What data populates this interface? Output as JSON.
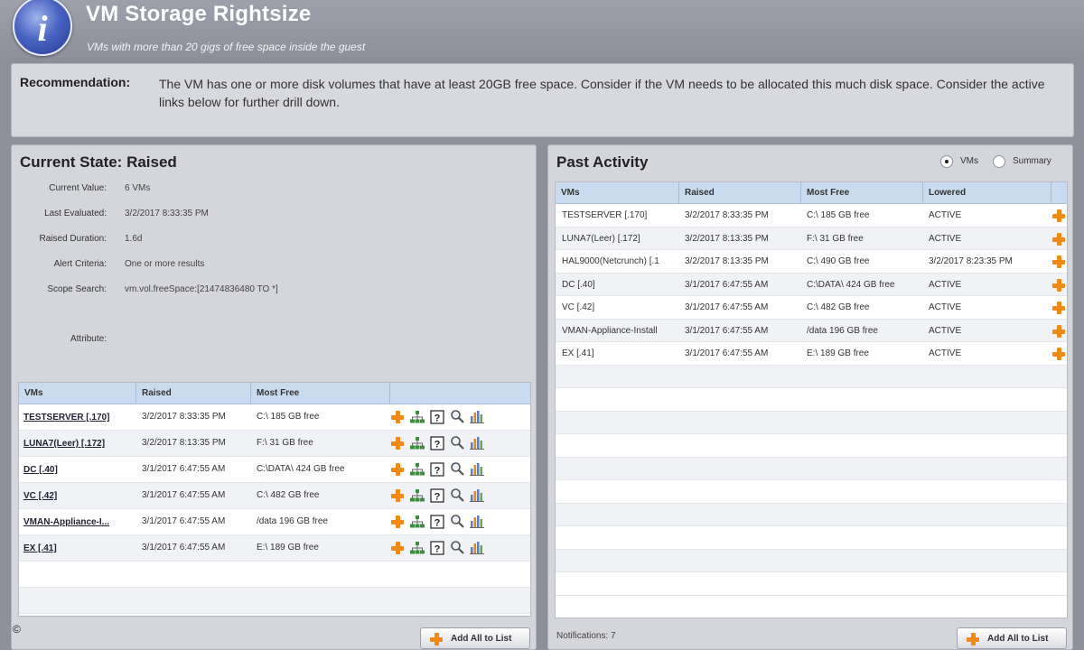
{
  "header": {
    "icon": "info-icon",
    "icon_glyph": "i",
    "title": "VM Storage Rightsize",
    "subtitle": "VMs with more than 20 gigs of free space inside the guest"
  },
  "recommendation": {
    "label": "Recommendation:",
    "text": "The VM has one or more disk volumes that have at least 20GB free space. Consider if the VM needs to be allocated this much disk space. Consider the active links below for further drill down."
  },
  "current_state": {
    "title": "Current State: Raised",
    "details": [
      {
        "label": "Current Value:",
        "value": "6 VMs"
      },
      {
        "label": "Last Evaluated:",
        "value": "3/2/2017 8:33:35 PM"
      },
      {
        "label": "Raised Duration:",
        "value": "1.6d"
      },
      {
        "label": "Alert Criteria:",
        "value": "One or more results"
      },
      {
        "label": "Scope Search:",
        "value": "vm.vol.freeSpace:[21474836480 TO *]"
      },
      {
        "label": "Attribute:",
        "value": ""
      }
    ],
    "columns": [
      "VMs",
      "Raised",
      "Most Free"
    ],
    "rows": [
      {
        "vm": "TESTSERVER [.170]",
        "raised": "3/2/2017 8:33:35 PM",
        "most_free": "C:\\ 185 GB free"
      },
      {
        "vm": "LUNA7(Leer) [.172]",
        "raised": "3/2/2017 8:13:35 PM",
        "most_free": "F:\\ 31 GB free"
      },
      {
        "vm": "DC [.40]",
        "raised": "3/1/2017 6:47:55 AM",
        "most_free": "C:\\DATA\\ 424 GB free"
      },
      {
        "vm": "VC [.42]",
        "raised": "3/1/2017 6:47:55 AM",
        "most_free": "C:\\ 482 GB free"
      },
      {
        "vm": "VMAN-Appliance-I...",
        "raised": "3/1/2017 6:47:55 AM",
        "most_free": "/data 196 GB free"
      },
      {
        "vm": "EX [.41]",
        "raised": "3/1/2017 6:47:55 AM",
        "most_free": "E:\\ 189 GB free"
      }
    ],
    "row_icons": [
      "plus-icon",
      "tree-icon",
      "help-doc-icon",
      "magnifier-icon",
      "bar-chart-icon"
    ],
    "add_all_label": "Add All to List"
  },
  "past_activity": {
    "title": "Past Activity",
    "radio_options": [
      {
        "label": "VMs",
        "checked": true
      },
      {
        "label": "Summary",
        "checked": false
      }
    ],
    "columns": [
      "VMs",
      "Raised",
      "Most Free",
      "Lowered"
    ],
    "rows": [
      {
        "vm": "TESTSERVER [.170]",
        "raised": "3/2/2017 8:33:35 PM",
        "most_free": "C:\\ 185 GB free",
        "lowered": "ACTIVE"
      },
      {
        "vm": "LUNA7(Leer) [.172]",
        "raised": "3/2/2017 8:13:35 PM",
        "most_free": "F:\\ 31 GB free",
        "lowered": "ACTIVE"
      },
      {
        "vm": "HAL9000(Netcrunch) [.1",
        "raised": "3/2/2017 8:13:35 PM",
        "most_free": "C:\\ 490 GB free",
        "lowered": "3/2/2017 8:23:35 PM"
      },
      {
        "vm": "DC [.40]",
        "raised": "3/1/2017 6:47:55 AM",
        "most_free": "C:\\DATA\\ 424 GB free",
        "lowered": "ACTIVE"
      },
      {
        "vm": "VC [.42]",
        "raised": "3/1/2017 6:47:55 AM",
        "most_free": "C:\\ 482 GB free",
        "lowered": "ACTIVE"
      },
      {
        "vm": "VMAN-Appliance-Install",
        "raised": "3/1/2017 6:47:55 AM",
        "most_free": "/data 196 GB free",
        "lowered": "ACTIVE"
      },
      {
        "vm": "EX [.41]",
        "raised": "3/1/2017 6:47:55 AM",
        "most_free": "E:\\ 189 GB free",
        "lowered": "ACTIVE"
      }
    ],
    "notifications": "Notifications: 7",
    "add_all_label": "Add All to List"
  },
  "copyright": "©",
  "colors": {
    "accent_orange": "#f08a14",
    "table_header": "#c9dcef",
    "background": "#8e919c"
  }
}
